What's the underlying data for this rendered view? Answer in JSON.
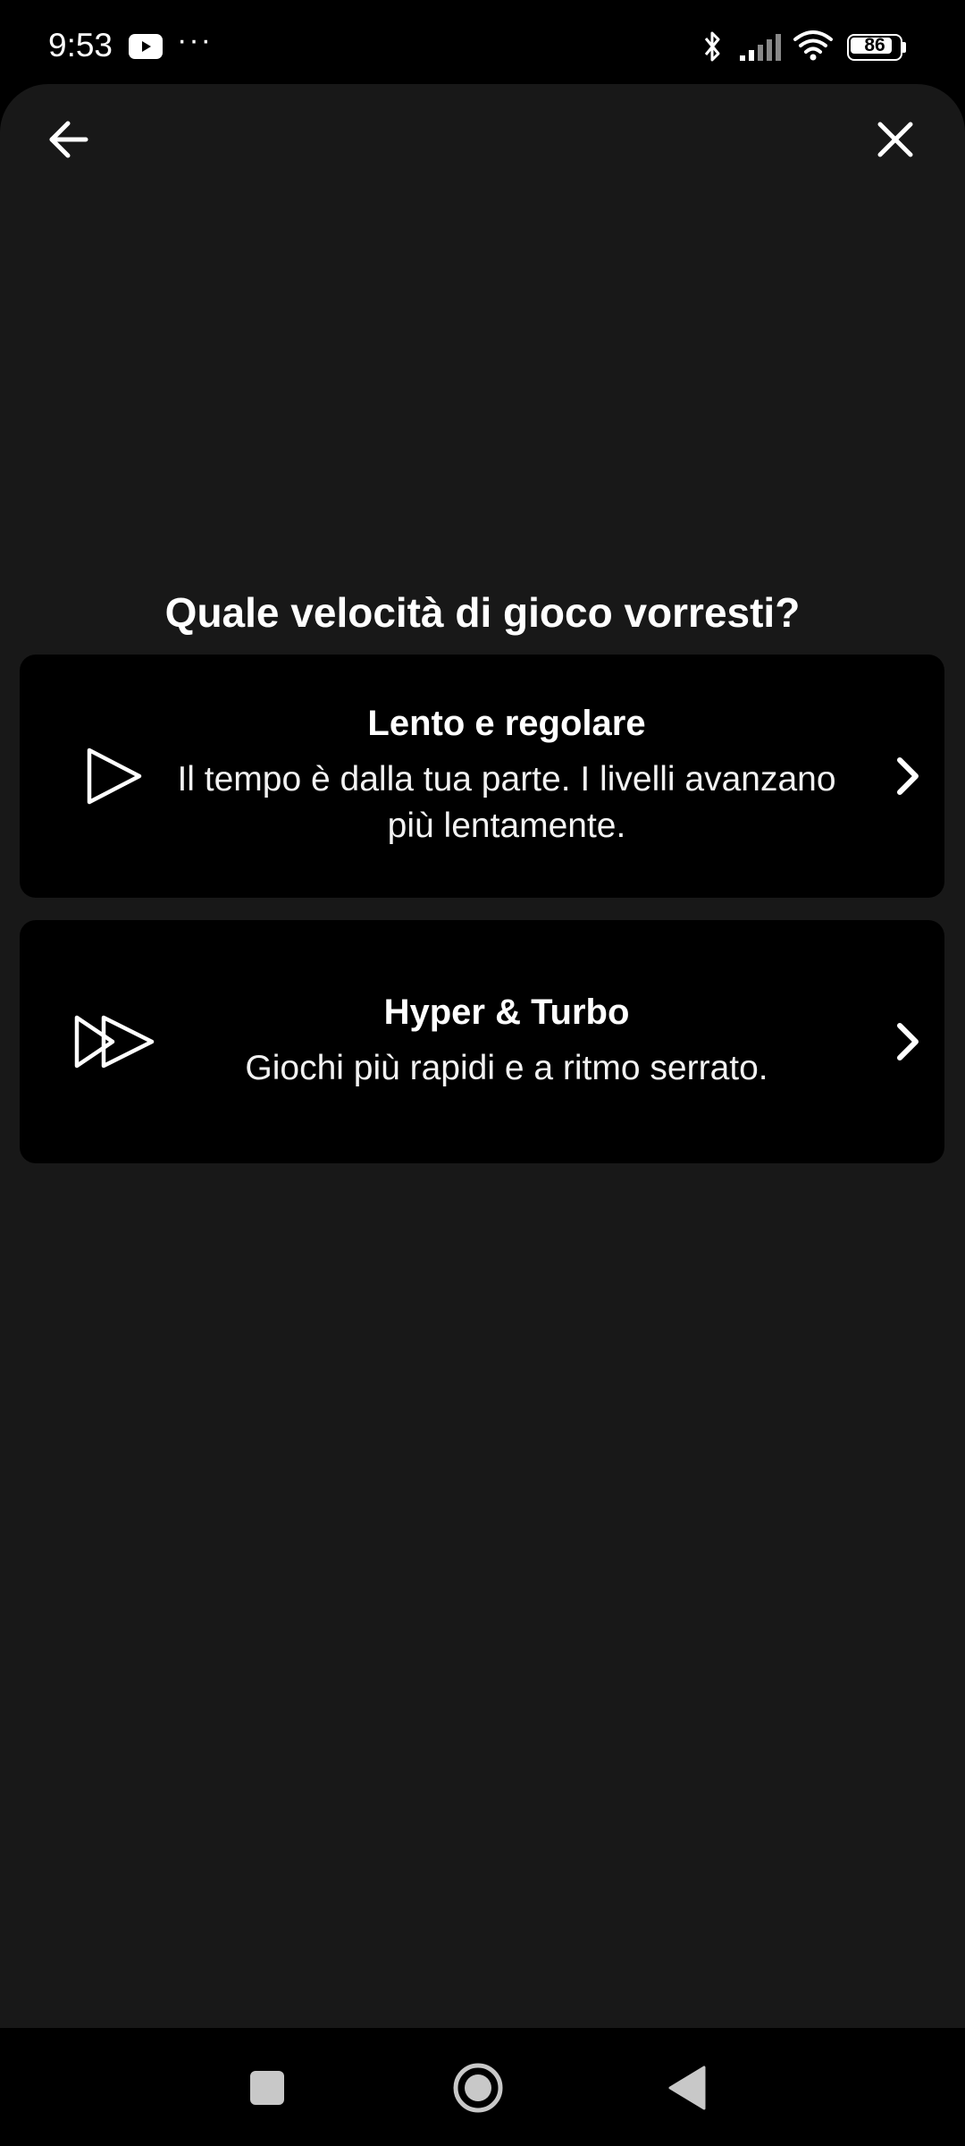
{
  "status_bar": {
    "time": "9:53",
    "overflow": "···",
    "battery": "86",
    "battery_level": 0.86,
    "icons": [
      "youtube-icon",
      "bluetooth-icon",
      "signal-icon",
      "wifi-icon",
      "battery-icon"
    ]
  },
  "header": {
    "back_icon": "arrow-left-icon",
    "close_icon": "close-icon"
  },
  "page": {
    "title": "Quale velocità di gioco vorresti?"
  },
  "options": [
    {
      "title": "Lento e regolare",
      "description": "Il tempo è dalla tua parte. I livelli avanzano più lentamente.",
      "icon": "play-icon"
    },
    {
      "title": "Hyper & Turbo",
      "description": "Giochi più rapidi e a ritmo serrato.",
      "icon": "fast-forward-icon"
    }
  ],
  "colors": {
    "background": "#181818",
    "card": "#000000",
    "text": "#ffffff"
  }
}
